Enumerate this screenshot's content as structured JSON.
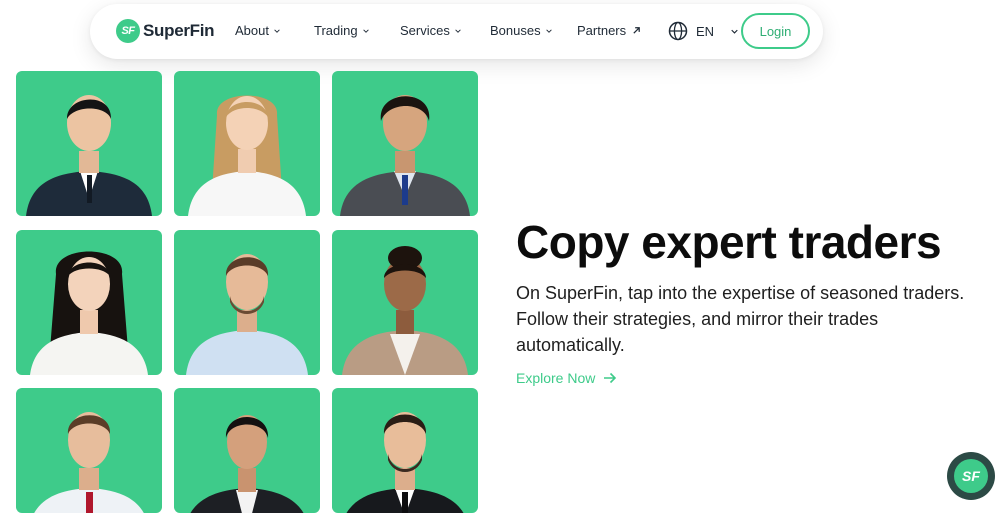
{
  "brand": {
    "logo_mark": "SF",
    "name": "SuperFin"
  },
  "nav": {
    "items": [
      {
        "label": "About",
        "icon": "chevron-down-icon"
      },
      {
        "label": "Trading",
        "icon": "chevron-down-icon"
      },
      {
        "label": "Services",
        "icon": "chevron-down-icon"
      },
      {
        "label": "Bonuses",
        "icon": "chevron-down-icon"
      },
      {
        "label": "Partners",
        "icon": "external-arrow-icon"
      }
    ],
    "language": "EN",
    "login_label": "Login"
  },
  "hero": {
    "title": "Copy expert traders",
    "description": "On SuperFin, tap into the expertise of seasoned traders. Follow their strategies, and mirror their trades automatically.",
    "cta_label": "Explore Now"
  },
  "fab": {
    "label": "SF"
  },
  "colors": {
    "accent": "#3ecb8a",
    "fab_bg": "#2c4a45",
    "text": "#1f2a36"
  }
}
